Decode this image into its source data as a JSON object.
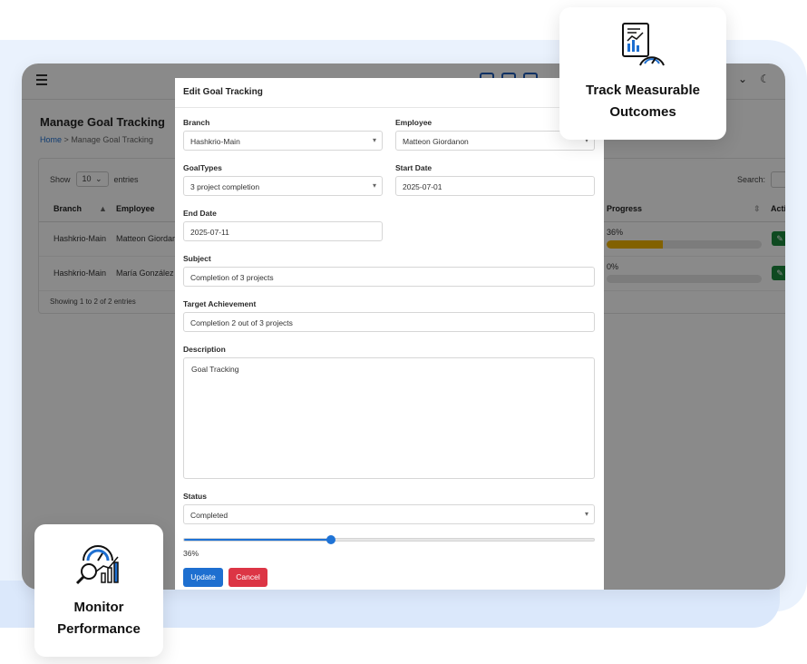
{
  "features": {
    "top_line1": "Track Measurable",
    "top_line2": "Outcomes",
    "bottom_line1": "Monitor",
    "bottom_line2": "Performance"
  },
  "page": {
    "title": "Manage Goal Tracking",
    "breadcrumb_home": "Home",
    "breadcrumb_sep": ">",
    "breadcrumb_current": "Manage Goal Tracking"
  },
  "table": {
    "show_label": "Show",
    "show_value": "10",
    "entries_label": "entries",
    "search_label": "Search:",
    "headers": {
      "branch": "Branch",
      "employee": "Employee",
      "progress": "Progress",
      "actions": "Acti"
    },
    "rows": [
      {
        "branch": "Hashkrio-Main",
        "employee": "Matteon Giordar",
        "progress_text": "36%",
        "progress_value": 36
      },
      {
        "branch": "Hashkrio-Main",
        "employee": "María González",
        "progress_text": "0%",
        "progress_value": 0
      }
    ],
    "showing": "Showing 1 to 2 of 2 entries"
  },
  "modal": {
    "title": "Edit Goal Tracking",
    "branch_label": "Branch",
    "branch_value": "Hashkrio-Main",
    "employee_label": "Employee",
    "employee_value": "Matteon Giordanon",
    "goaltypes_label": "GoalTypes",
    "goaltypes_value": "3 project completion",
    "start_label": "Start Date",
    "start_value": "2025-07-01",
    "end_label": "End Date",
    "end_value": "2025-07-11",
    "subject_label": "Subject",
    "subject_value": "Completion of 3 projects",
    "target_label": "Target Achievement",
    "target_value": "Completion 2 out of 3 projects",
    "description_label": "Description",
    "description_value": "Goal Tracking",
    "status_label": "Status",
    "status_value": "Completed",
    "progress_value": 36,
    "progress_text": "36%",
    "update_label": "Update",
    "cancel_label": "Cancel"
  },
  "colors": {
    "primary": "#1e6fd0",
    "danger": "#dc3545",
    "progress_bar": "#f0b400",
    "action_green": "#1c8a3d",
    "background_tint": "#eaf2fd"
  },
  "icons": [
    "menu-icon",
    "dark-mode-icon",
    "chevron-down-icon",
    "sort-icon",
    "edit-icon",
    "report-gauge-icon",
    "performance-magnifier-icon"
  ]
}
